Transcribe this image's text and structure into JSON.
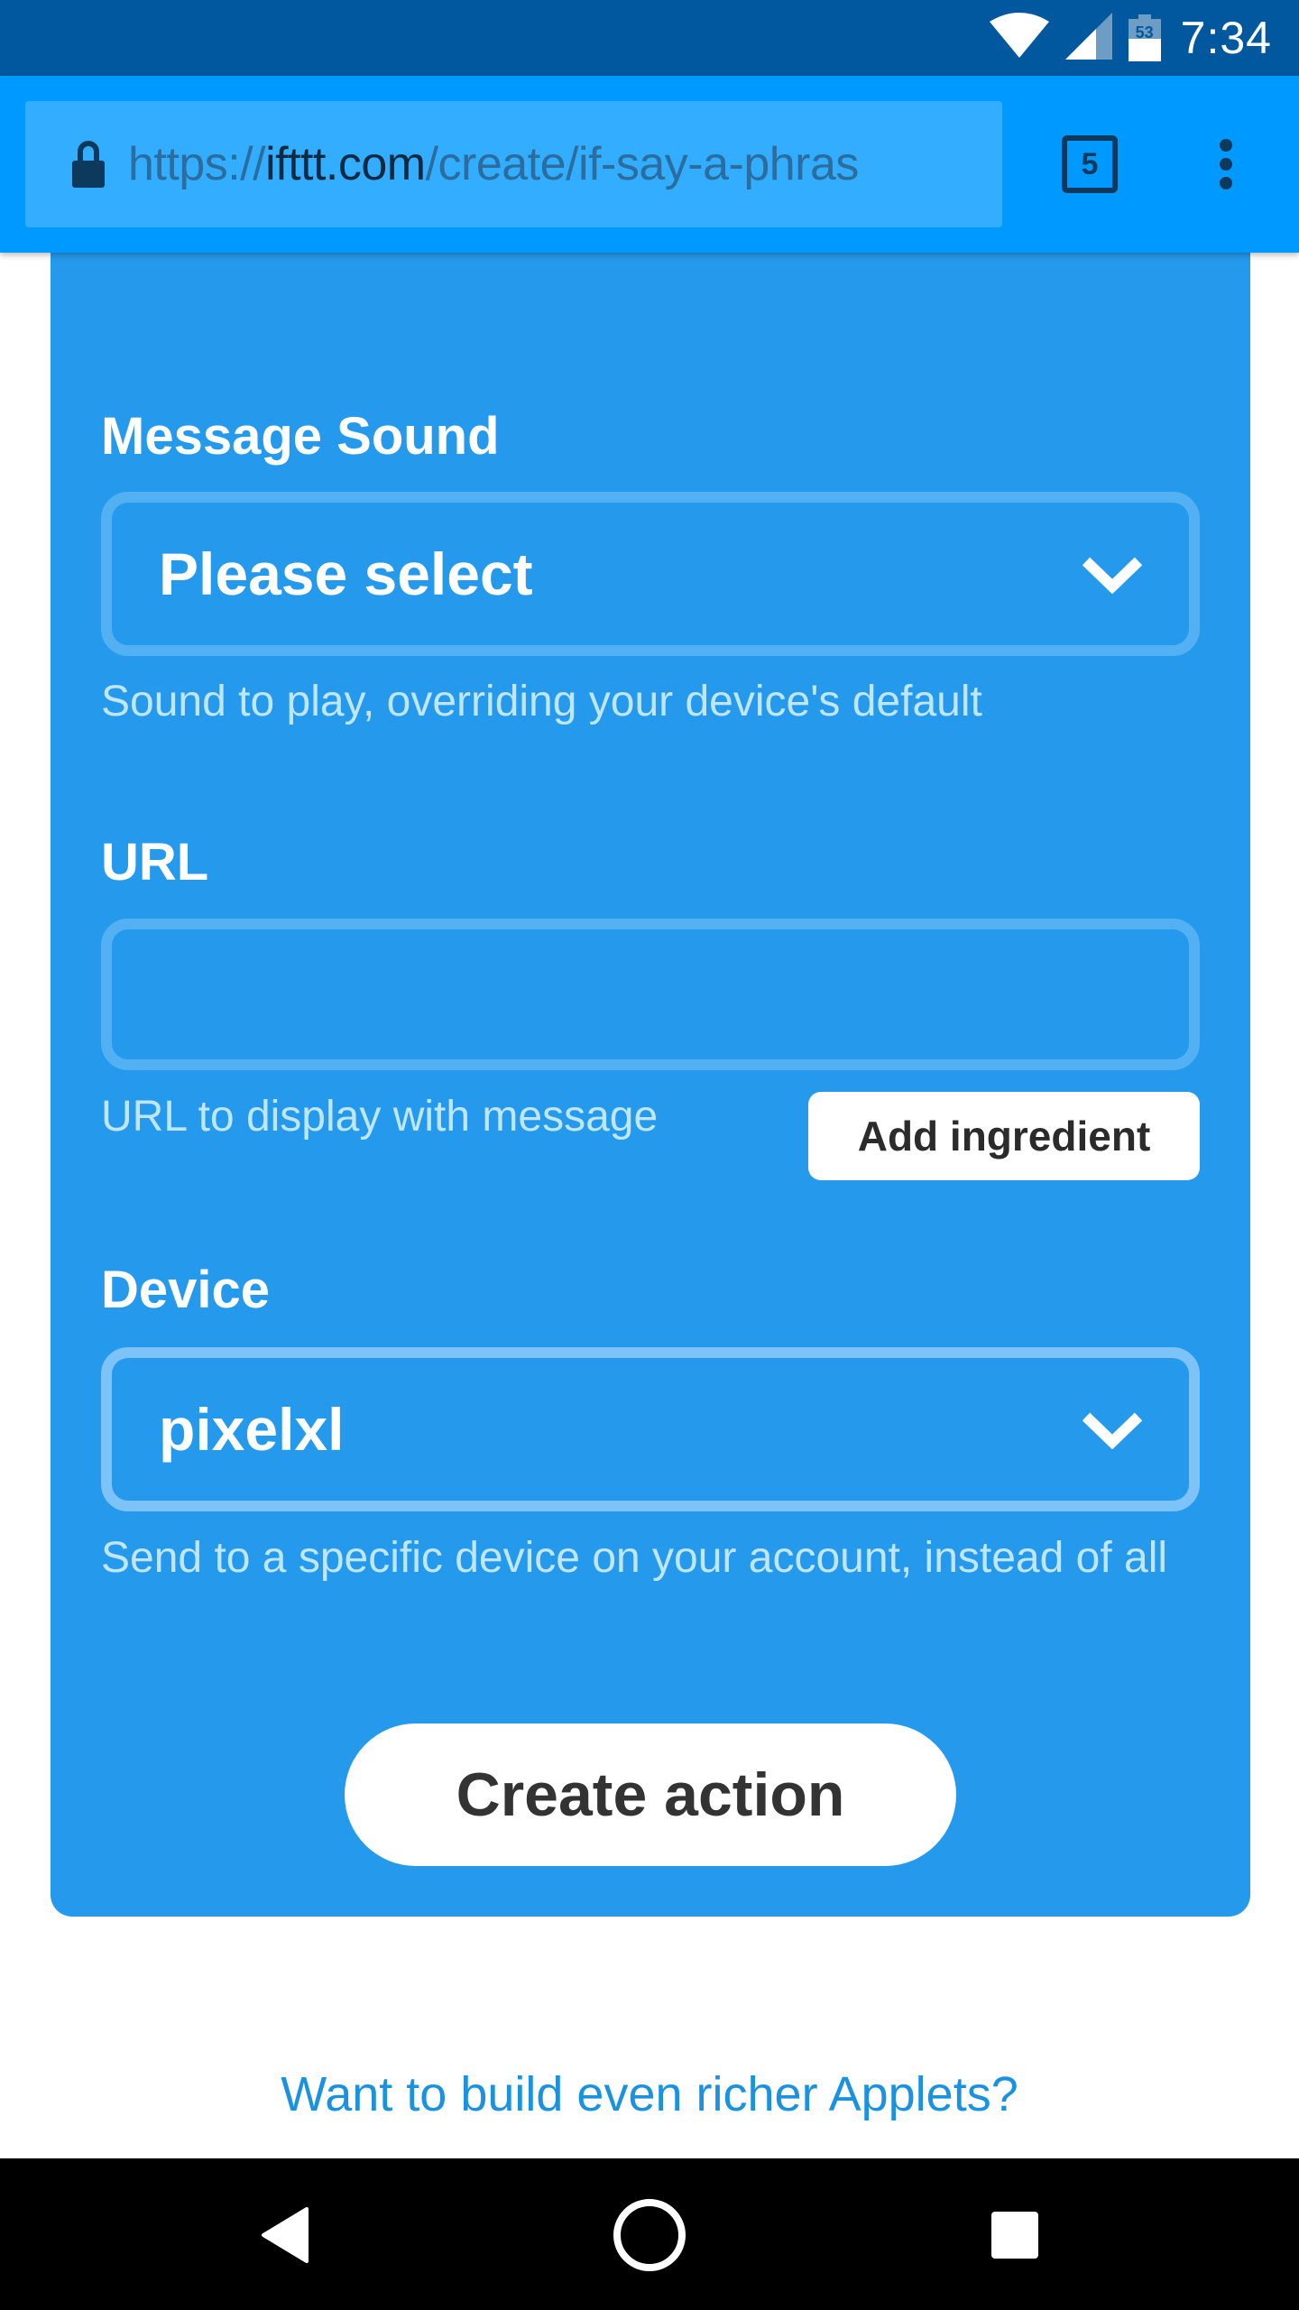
{
  "status_bar": {
    "time": "7:34",
    "battery_percent": "53",
    "icons": [
      "wifi-icon",
      "cell-signal-icon",
      "battery-icon"
    ]
  },
  "browser": {
    "url_prefix": "https://",
    "url_domain": "ifttt.com",
    "url_path": "/create/if-say-a-phras",
    "tab_count": "5",
    "icons": [
      "lock-icon",
      "tabs-icon",
      "more-vert-icon"
    ]
  },
  "form": {
    "message_sound": {
      "label": "Message Sound",
      "value": "Please select",
      "help": "Sound to play, overriding your device's default"
    },
    "url": {
      "label": "URL",
      "value": "",
      "help": "URL to display with message",
      "ingredient_button": "Add ingredient"
    },
    "device": {
      "label": "Device",
      "value": "pixelxl",
      "help": "Send to a specific device on your account, instead of all"
    },
    "create_button": "Create action"
  },
  "footer": {
    "link": "Want to build even richer Applets?"
  },
  "colors": {
    "status_bar": "#02589e",
    "toolbar": "#0099ff",
    "card": "#259aec",
    "link": "#1a92e0"
  }
}
